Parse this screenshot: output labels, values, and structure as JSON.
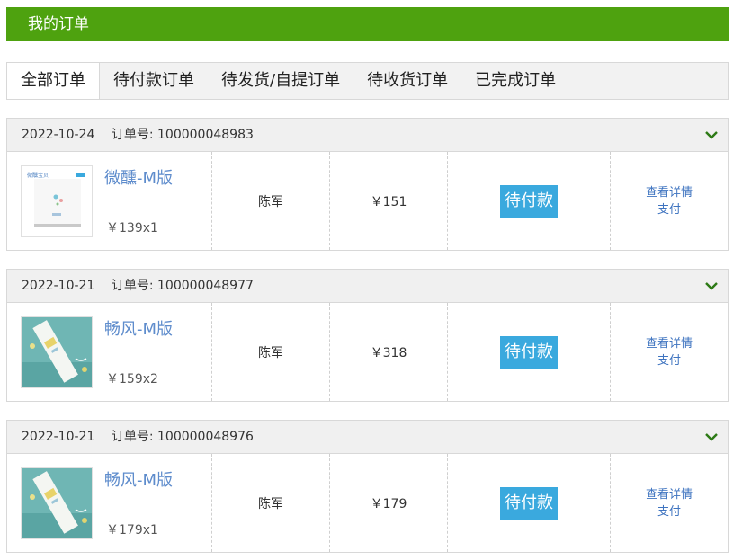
{
  "page_title": "我的订单",
  "tabs": [
    {
      "label": "全部订单"
    },
    {
      "label": "待付款订单"
    },
    {
      "label": "待发货/自提订单"
    },
    {
      "label": "待收货订单"
    },
    {
      "label": "已完成订单"
    }
  ],
  "orders": [
    {
      "date": "2022-10-24",
      "order_no_label": "订单号:",
      "order_no": "100000048983",
      "product_name": "微醺-M版",
      "unit_qty": "￥139x1",
      "recipient": "陈军",
      "total": "￥151",
      "status": "待付款",
      "actions": {
        "details": "查看详情",
        "pay": "支付"
      },
      "thumb": "white-box",
      "thumb_text": "微醺宝贝"
    },
    {
      "date": "2022-10-21",
      "order_no_label": "订单号:",
      "order_no": "100000048977",
      "product_name": "畅风-M版",
      "unit_qty": "￥159x2",
      "recipient": "陈军",
      "total": "￥318",
      "status": "待付款",
      "actions": {
        "details": "查看详情",
        "pay": "支付"
      },
      "thumb": "teal-pack"
    },
    {
      "date": "2022-10-21",
      "order_no_label": "订单号:",
      "order_no": "100000048976",
      "product_name": "畅风-M版",
      "unit_qty": "￥179x1",
      "recipient": "陈军",
      "total": "￥179",
      "status": "待付款",
      "actions": {
        "details": "查看详情",
        "pay": "支付"
      },
      "thumb": "teal-pack"
    }
  ],
  "colors": {
    "title_bar": "#4ea20f",
    "status_button": "#3aa9de",
    "link": "#3f74c0",
    "product_name": "#5e8ccc",
    "chevron": "#2d7a16"
  },
  "icons": {
    "expand": "chevron-down-icon"
  }
}
